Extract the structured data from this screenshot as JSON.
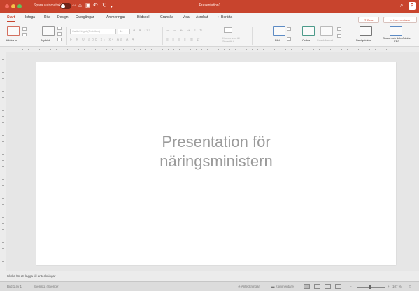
{
  "titlebar": {
    "autosave_label": "Spara automatiskt",
    "autosave_toggle": "AV",
    "doc_title": "Presentation1"
  },
  "tabs": [
    {
      "label": "Start",
      "active": true
    },
    {
      "label": "Infoga"
    },
    {
      "label": "Rita"
    },
    {
      "label": "Design"
    },
    {
      "label": "Övergångar"
    },
    {
      "label": "Animeringar"
    },
    {
      "label": "Bildspel"
    },
    {
      "label": "Granska"
    },
    {
      "label": "Visa"
    },
    {
      "label": "Acrobat"
    },
    {
      "label": "Berätta"
    }
  ],
  "actions": {
    "share": "Dela",
    "comments": "Kommentarer"
  },
  "ribbon": {
    "paste": "Klistra in",
    "new_slide": "Ny bild",
    "font": "Calibri Light (Rubriker)",
    "size": "44",
    "convert": "Konvertera till SmartArt",
    "picture": "Bild",
    "arrange": "Ordna",
    "quick_styles": "Snabbformat",
    "designer": "Designidéer",
    "create_pdf": "Skapa och dela Adobe PDF"
  },
  "slide": {
    "title_line1": "Presentation för",
    "title_line2": "näringsministern"
  },
  "notes": {
    "placeholder": "Klicka för att lägga till anteckningar"
  },
  "status": {
    "slide_count": "Bild 1 av 1",
    "language": "Svenska (Sverige)",
    "notes_btn": "Anteckningar",
    "comments_btn": "Kommentarer",
    "zoom": "107 %"
  },
  "colors": {
    "accent": "#c8442d"
  }
}
